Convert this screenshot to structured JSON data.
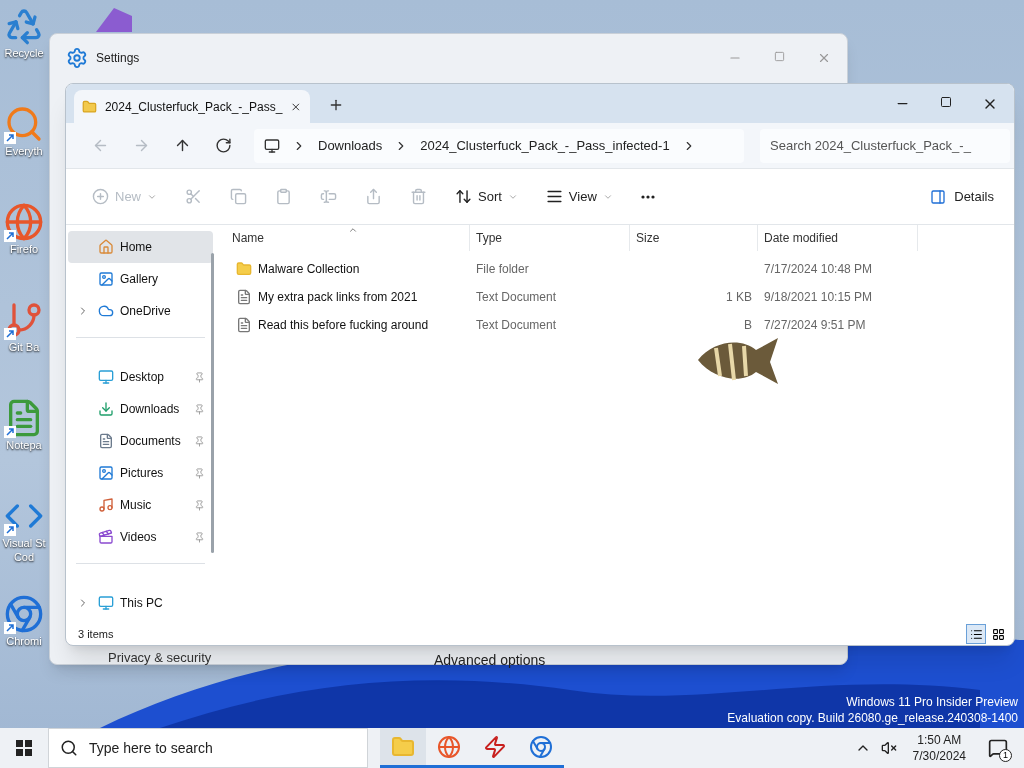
{
  "desktop_icons": [
    {
      "kind": "recycle",
      "lines": [
        "Recycle"
      ],
      "shortcut": false
    },
    {
      "kind": "magnifier",
      "lines": [
        "Everyth"
      ],
      "shortcut": true
    },
    {
      "kind": "firefox",
      "lines": [
        "Firefo"
      ],
      "shortcut": true
    },
    {
      "kind": "git",
      "lines": [
        "Git Ba"
      ],
      "shortcut": true
    },
    {
      "kind": "notepad",
      "lines": [
        "Notepa"
      ],
      "shortcut": true
    },
    {
      "kind": "vscode",
      "lines": [
        "Visual St",
        "Cod"
      ],
      "shortcut": true
    },
    {
      "kind": "chrome",
      "lines": [
        "Chromi"
      ],
      "shortcut": true
    }
  ],
  "settings": {
    "title": "Settings",
    "nav_item": "Privacy & security",
    "footer_link": "Advanced options"
  },
  "explorer": {
    "tabs": [
      {
        "title": "2024_Clusterfuck_Pack_-_Pass_",
        "selected": true
      }
    ],
    "nav": [
      {
        "kind": "back",
        "disabled": true
      },
      {
        "kind": "forward",
        "disabled": true
      },
      {
        "kind": "up",
        "disabled": false
      },
      {
        "kind": "refresh",
        "disabled": false
      }
    ],
    "breadcrumb": [
      "Downloads",
      "2024_Clusterfuck_Pack_-_Pass_infected-1"
    ],
    "search": {
      "placeholder": "Search 2024_Clusterfuck_Pack_-_"
    },
    "toolbar": [
      {
        "kind": "new",
        "label": "New",
        "disabled": true
      },
      {
        "kind": "cut",
        "disabled": true
      },
      {
        "kind": "copy",
        "disabled": true
      },
      {
        "kind": "paste",
        "disabled": true
      },
      {
        "kind": "rename",
        "disabled": true
      },
      {
        "kind": "share",
        "disabled": true
      },
      {
        "kind": "delete",
        "disabled": true
      },
      {
        "kind": "sort",
        "label": "Sort",
        "disabled": false
      },
      {
        "kind": "view",
        "label": "View",
        "disabled": false
      },
      {
        "kind": "more",
        "disabled": false
      }
    ],
    "details_button": "Details",
    "sidebar": [
      {
        "kind": "home",
        "label": "Home",
        "selected": true,
        "expandable": false,
        "pinned": false
      },
      {
        "kind": "gallery",
        "label": "Gallery",
        "selected": false,
        "expandable": false,
        "pinned": false
      },
      {
        "kind": "onedrive",
        "label": "OneDrive",
        "selected": false,
        "expandable": true,
        "pinned": false
      },
      {
        "kind": "divider"
      },
      {
        "kind": "desktop",
        "label": "Desktop",
        "selected": false,
        "expandable": false,
        "pinned": true
      },
      {
        "kind": "downloads",
        "label": "Downloads",
        "selected": false,
        "expandable": false,
        "pinned": true
      },
      {
        "kind": "documents",
        "label": "Documents",
        "selected": false,
        "expandable": false,
        "pinned": true
      },
      {
        "kind": "pictures",
        "label": "Pictures",
        "selected": false,
        "expandable": false,
        "pinned": true
      },
      {
        "kind": "music",
        "label": "Music",
        "selected": false,
        "expandable": false,
        "pinned": true
      },
      {
        "kind": "videos",
        "label": "Videos",
        "selected": false,
        "expandable": false,
        "pinned": true
      },
      {
        "kind": "divider"
      },
      {
        "kind": "thispc",
        "label": "This PC",
        "selected": false,
        "expandable": true,
        "pinned": false
      }
    ],
    "columns": [
      {
        "label": "Name",
        "sorted": true
      },
      {
        "label": "Type",
        "sorted": false
      },
      {
        "label": "Size",
        "sorted": false
      },
      {
        "label": "Date modified",
        "sorted": false
      }
    ],
    "rows": [
      {
        "kind": "folder",
        "name": "Malware Collection",
        "type": "File folder",
        "date": "7/17/2024 10:48 PM"
      },
      {
        "kind": "text",
        "name": "My extra pack links from 2021",
        "type": "Text Document",
        "size": "1 KB",
        "date": "9/18/2021 10:15 PM"
      },
      {
        "kind": "text",
        "name": "Read this before fucking around",
        "type": "Text Document",
        "size": "B",
        "date": "7/27/2024 9:51 PM"
      }
    ],
    "status": "3 items",
    "view_buttons": [
      {
        "kind": "details",
        "selected": true
      },
      {
        "kind": "tiles",
        "selected": false
      }
    ]
  },
  "watermark": [
    "Windows 11 Pro Insider Preview",
    "Evaluation copy. Build 26080.ge_release.240308-1400"
  ],
  "taskbar": {
    "search": {
      "placeholder": "Type here to search"
    },
    "apps": [
      {
        "kind": "explorer",
        "active": true
      },
      {
        "kind": "firefox",
        "active": true
      },
      {
        "kind": "filezilla",
        "active": true
      },
      {
        "kind": "chrome",
        "active": true
      }
    ],
    "time": "1:50 AM",
    "date": "7/30/2024",
    "notifications": "1"
  }
}
